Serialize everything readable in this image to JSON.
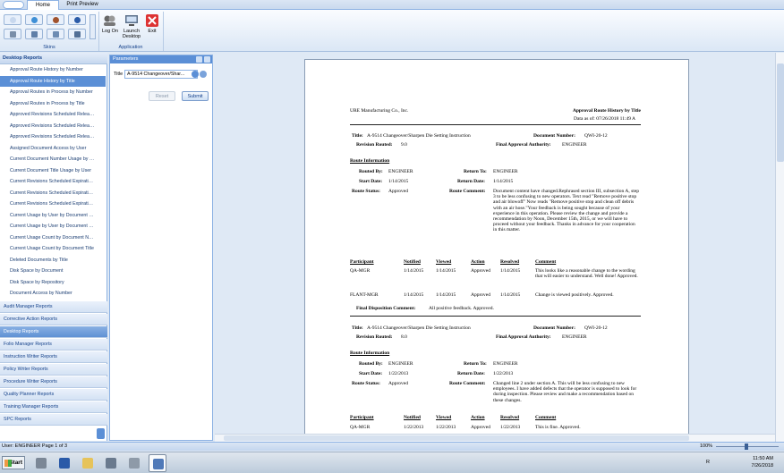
{
  "ribbon": {
    "tabs": [
      "Home",
      "Print Preview"
    ],
    "skins_label": "Skins",
    "application_label": "Application",
    "buttons": {
      "logon": "Log On",
      "launch_desktop_1": "Launch",
      "launch_desktop_2": "Desktop",
      "exit": "Exit"
    }
  },
  "sidebar": {
    "header": "Desktop Reports",
    "reports": [
      "Approval Route History by Number",
      "Approval Route History by Title",
      "Approval Routes in Process by Number",
      "Approval Routes in Process by Title",
      "Approved Revisions Scheduled Releas...",
      "Approved Revisions Scheduled Releas...",
      "Approved Revisions Scheduled Releas...",
      "Assigned Document Access by User",
      "Current Document Number Usage by U...",
      "Current Document Title Usage by User",
      "Current Revisions Scheduled Expiratio...",
      "Current Revisions Scheduled Expiratio...",
      "Current Revisions Scheduled Expiratio...",
      "Current Usage by User by Document N...",
      "Current Usage by User by Document Title",
      "Current Usage Count by Document Nu...",
      "Current Usage Count by Document Title",
      "Deleted Documents by Title",
      "Disk Space by Document",
      "Disk Space by Repository",
      "Document Access by Number"
    ],
    "selected_index": 1,
    "categories": [
      "Audit Manager Reports",
      "Corrective Action Reports",
      "Desktop Reports",
      "Folio Manager Reports",
      "Instruction Writer Reports",
      "Policy Writer Reports",
      "Procedure Writer Reports",
      "Quality Planner Reports",
      "Training Manager Reports",
      "SPC Reports"
    ],
    "active_category": "Desktop Reports"
  },
  "parameters": {
    "header": "Parameters",
    "title_label": "Title",
    "title_value": "A-9514 Changeover/Shar...",
    "reset_label": "Reset",
    "submit_label": "Submit"
  },
  "report": {
    "company": "URE Manufacturing Co., Inc.",
    "report_title": "Approval Route History by Title",
    "data_as_of": "Data as of: 07/26/2018  11:49 A",
    "blocks": [
      {
        "title_label": "Title:",
        "title": "A-9514 Changeover/Sharpen Die Setting Instruction",
        "docnum_label": "Document Number:",
        "docnum": "QWI-20-12",
        "rev_label": "Revision Routed:",
        "rev": "9.0",
        "final_label": "Final Approval Authority:",
        "final": "ENGINEER",
        "route_info": "Route Information",
        "routed_by_label": "Routed By:",
        "routed_by": "ENGINEER",
        "return_to_label": "Return To:",
        "return_to": "ENGINEER",
        "start_label": "Start Date:",
        "start": "1/14/2015",
        "return_date_label": "Return Date:",
        "return_date": "1/14/2015",
        "status_label": "Route Status:",
        "status": "Approved",
        "comment_label": "Route Comment:",
        "comment": "Document content have changed.Rephrased section III, subsection A, step 3 to be less confusing to new operators. Text read \"Remove positive stop and air blowoff\" Now reads \"Remove positive stop and clean off debris with an air hose.\"Your feedback is being sought because of your experience in this operation. Please review the change and provide a recommendation by Noon, December 15th, 2015, or we will have to proceed without your feedback. Thanks in advance for your cooperation in this matter.",
        "columns": [
          "Participant",
          "Notified",
          "Viewed",
          "Action",
          "Resolved",
          "Comment"
        ],
        "rows": [
          [
            "QA-MGR",
            "1/14/2015",
            "1/14/2015",
            "Approved",
            "1/14/2015",
            "This looks like a reasonable change to the wording that will easier to understand. Well done! Approved."
          ],
          [
            "FLANT-MGR",
            "1/14/2015",
            "1/14/2015",
            "Approved",
            "1/14/2015",
            "Change is viewed positively. Approved."
          ]
        ],
        "final_comment_label": "Final Disposition Comment:",
        "final_comment": "All positive feedback. Approved."
      },
      {
        "title_label": "Title:",
        "title": "A-9514 Changeover/Sharpen Die Setting Instruction",
        "docnum_label": "Document Number:",
        "docnum": "QWI-20-12",
        "rev_label": "Revision Routed:",
        "rev": "8.0",
        "final_label": "Final Approval Authority:",
        "final": "ENGINEER",
        "route_info": "Route Information",
        "routed_by_label": "Routed By:",
        "routed_by": "ENGINEER",
        "return_to_label": "Return To:",
        "return_to": "ENGINEER",
        "start_label": "Start Date:",
        "start": "1/22/2013",
        "return_date_label": "Return Date:",
        "return_date": "1/22/2013",
        "status_label": "Route Status:",
        "status": "Approved",
        "comment_label": "Route Comment:",
        "comment": "Changed line 2 under section A. This will be less confusing to new employees.  I have added defects that the operator is supposed to look for during inspection. Please review and make a recommendation based on these changes.",
        "columns": [
          "Participant",
          "Notified",
          "Viewed",
          "Action",
          "Resolved",
          "Comment"
        ],
        "rows": [
          [
            "QA-MGR",
            "1/22/2013",
            "1/22/2013",
            "Approved",
            "1/22/2013",
            "This is fine.  Approved."
          ]
        ]
      }
    ]
  },
  "status": {
    "user_page": "User: ENGINEER   Page 1 of 3",
    "zoom": "100%"
  },
  "taskbar": {
    "start": "Start",
    "time": "11:50 AM",
    "date": "7/26/2018",
    "tray_letter": "R"
  }
}
